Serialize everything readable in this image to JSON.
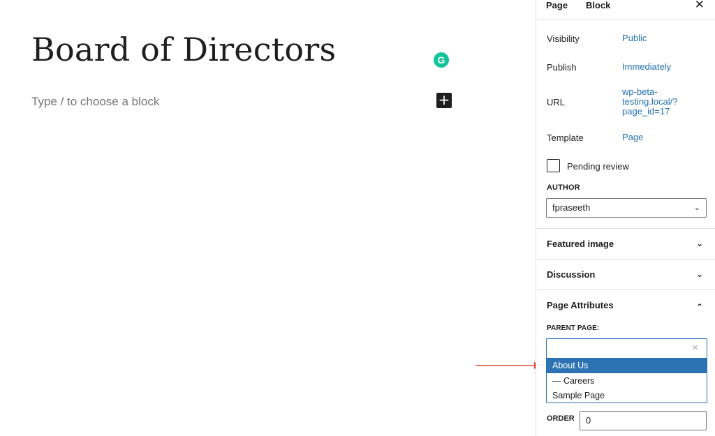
{
  "editor": {
    "title": "Board of Directors",
    "placeholder": "Type / to choose a block",
    "grammarly_letter": "G",
    "add_block_glyph": "+"
  },
  "sidebar": {
    "tabs": [
      {
        "label": "Page",
        "active": true
      },
      {
        "label": "Block",
        "active": false
      }
    ],
    "close_glyph": "✕",
    "rows": [
      {
        "label": "Visibility",
        "value": "Public"
      },
      {
        "label": "Publish",
        "value": "Immediately"
      },
      {
        "label": "URL",
        "value": "wp-beta-testing.local/?page_id=17"
      },
      {
        "label": "Template",
        "value": "Page"
      }
    ],
    "url_lines": [
      "wp-beta-",
      "testing.local/?",
      "page_id=17"
    ],
    "pending_review": {
      "label": "Pending review",
      "checked": false
    },
    "author": {
      "label": "AUTHOR",
      "value": "fpraseeth"
    },
    "panels": [
      {
        "title": "Featured image",
        "expanded": false
      },
      {
        "title": "Discussion",
        "expanded": false
      },
      {
        "title": "Page Attributes",
        "expanded": true
      }
    ],
    "page_attributes": {
      "parent_label": "PARENT PAGE:",
      "parent_value": "",
      "options": [
        {
          "label": "About Us",
          "highlighted": true
        },
        {
          "label": "— Careers",
          "highlighted": false
        },
        {
          "label": "Sample Page",
          "highlighted": false
        }
      ],
      "order_label": "ORDER",
      "order_value": "0"
    }
  },
  "colors": {
    "accent": "#2271b1",
    "highlight": "#2d73b4",
    "arrow": "#e24a33",
    "grammarly": "#15c39a"
  }
}
